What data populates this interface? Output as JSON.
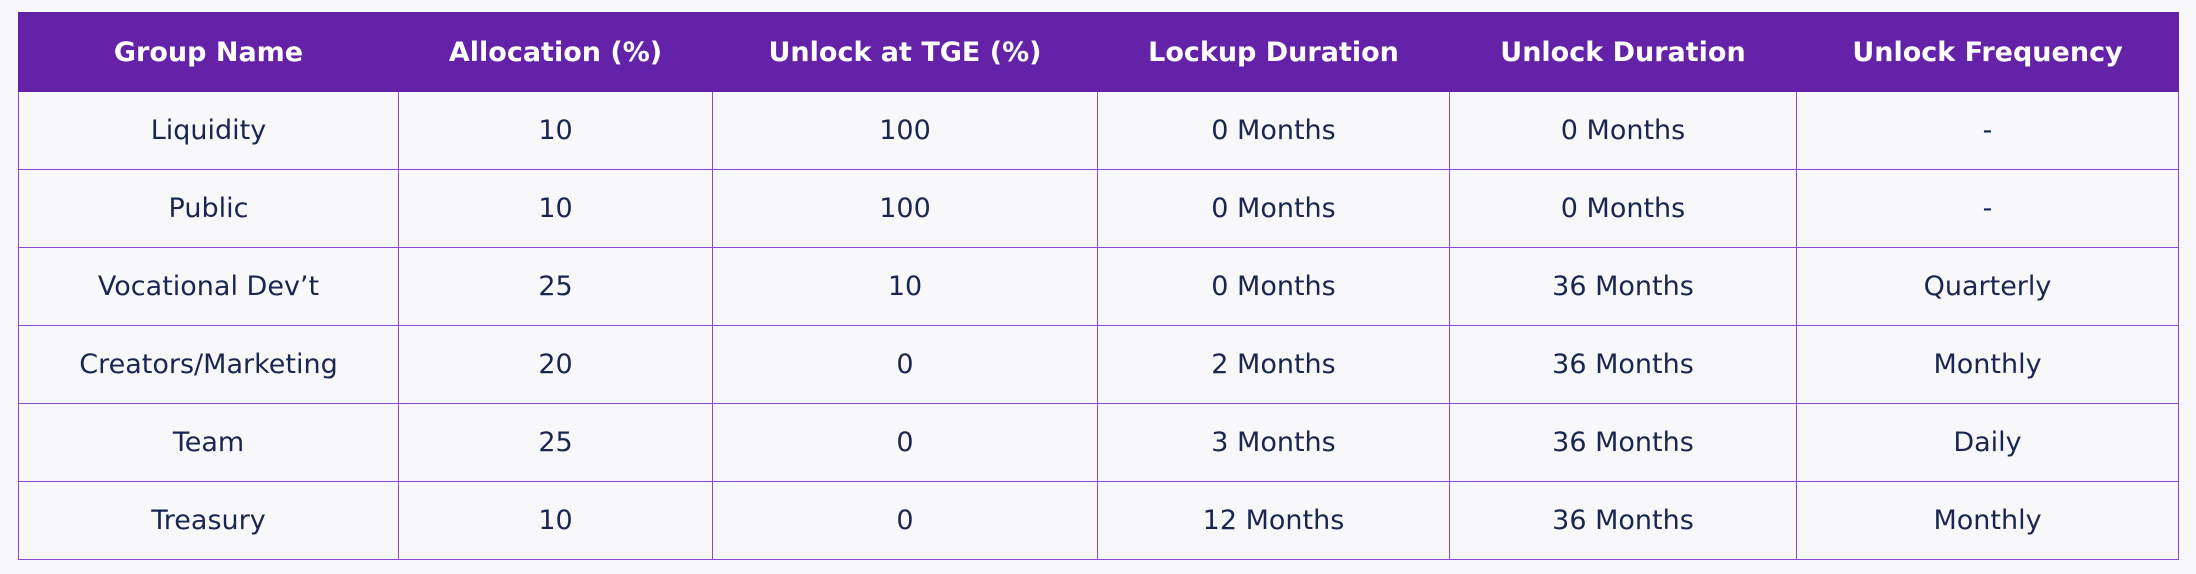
{
  "table": {
    "headers": [
      "Group Name",
      "Allocation (%)",
      "Unlock at TGE (%)",
      "Lockup Duration",
      "Unlock Duration",
      "Unlock Frequency"
    ],
    "rows": [
      [
        "Liquidity",
        "10",
        "100",
        "0 Months",
        "0 Months",
        "-"
      ],
      [
        "Public",
        "10",
        "100",
        "0 Months",
        "0 Months",
        "-"
      ],
      [
        "Vocational Dev’t",
        "25",
        "10",
        "0 Months",
        "36 Months",
        "Quarterly"
      ],
      [
        "Creators/Marketing",
        "20",
        "0",
        "2 Months",
        "36 Months",
        "Monthly"
      ],
      [
        "Team",
        "25",
        "0",
        "3 Months",
        "36 Months",
        "Daily"
      ],
      [
        "Treasury",
        "10",
        "0",
        "12 Months",
        "36 Months",
        "Monthly"
      ]
    ]
  },
  "colors": {
    "header_bg": "#6322a8",
    "header_text": "#ffffff",
    "border": "#8a4ad0",
    "cell_text": "#1a2550",
    "background": "#f8f8fa"
  }
}
